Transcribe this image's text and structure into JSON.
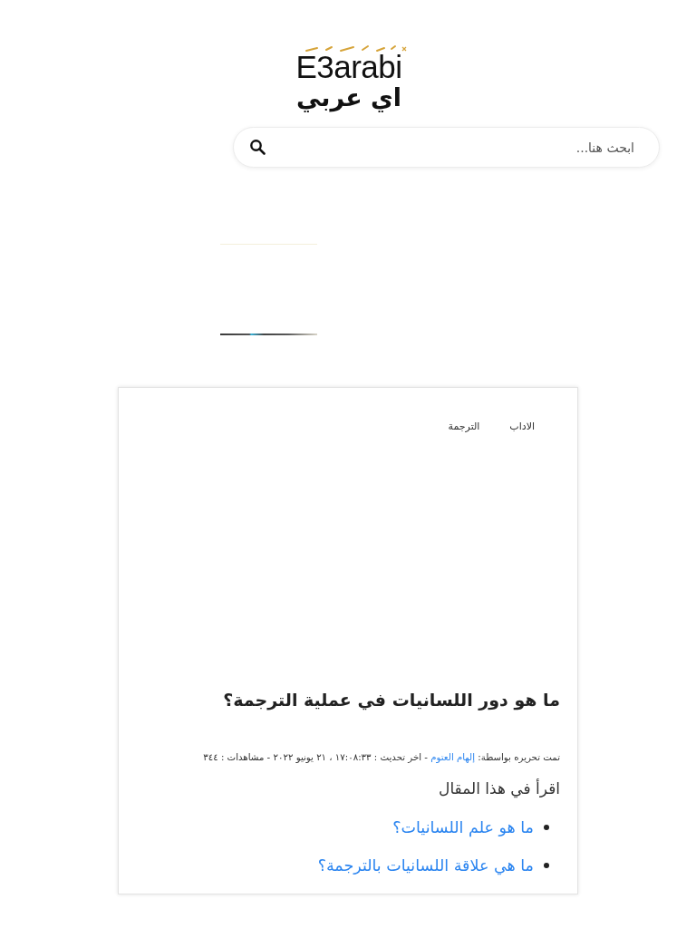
{
  "header": {
    "logo": {
      "latin": "E3arabi",
      "arabic": "اي عربي"
    },
    "search": {
      "placeholder": "ابحث هنا..."
    }
  },
  "article": {
    "categories": [
      "الاداب",
      "الترجمة"
    ],
    "title": "ما هو دور اللسانيات في عملية الترجمة؟",
    "meta": {
      "prefix": "تمت تحريره بواسطة: ",
      "author": "إلهام العتوم",
      "suffix": " - اخر تحديث : ١٧:٠٨:٣٣ ، ٢١ يونيو ٢٠٢٢ - مشاهدات : ٣٤٤"
    },
    "toc": {
      "heading": "اقرأ في هذا المقال",
      "items": [
        "ما هو علم اللسانيات؟",
        "ما هي علاقة اللسانيات بالترجمة؟"
      ]
    }
  }
}
